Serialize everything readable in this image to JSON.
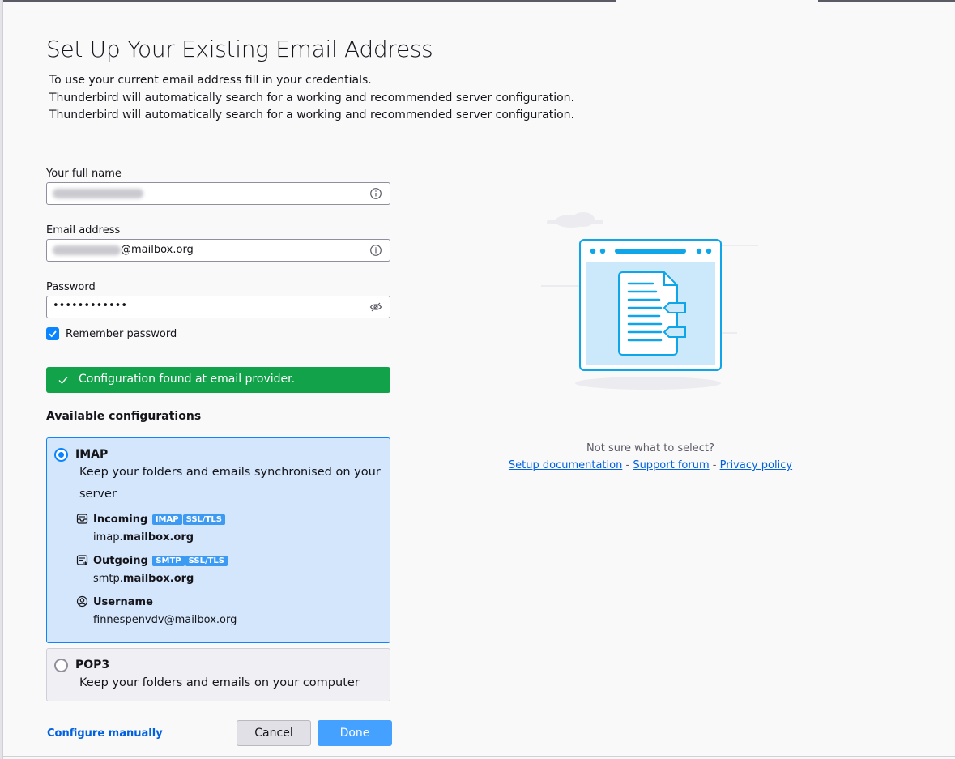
{
  "page": {
    "title": "Set Up Your Existing Email Address",
    "intro": [
      "To use your current email address fill in your credentials.",
      "Thunderbird will automatically search for a working and recommended server configuration.",
      "Thunderbird will automatically search for a working and recommended server configuration."
    ]
  },
  "form": {
    "name_label": "Your full name",
    "email_label": "Email address",
    "email_suffix": "@mailbox.org",
    "password_label": "Password",
    "password_value": "••••••••••••",
    "remember_label": "Remember password",
    "remember_checked": true
  },
  "notice": {
    "text": "Configuration found at email provider."
  },
  "configs": {
    "heading": "Available configurations",
    "imap": {
      "title": "IMAP",
      "desc_line1": "Keep your folders and emails synchronised on your",
      "desc_line2": "server",
      "incoming_label": "Incoming",
      "incoming_badges": [
        "IMAP",
        "SSL/TLS"
      ],
      "incoming_host_prefix": "imap.",
      "incoming_host_domain": "mailbox.org",
      "outgoing_label": "Outgoing",
      "outgoing_badges": [
        "SMTP",
        "SSL/TLS"
      ],
      "outgoing_host_prefix": "smtp.",
      "outgoing_host_domain": "mailbox.org",
      "username_label": "Username",
      "username_value": "finnespenvdv@mailbox.org"
    },
    "pop3": {
      "title": "POP3",
      "desc": "Keep your folders and emails on your computer"
    }
  },
  "actions": {
    "configure_manually": "Configure manually",
    "cancel": "Cancel",
    "done": "Done"
  },
  "help": {
    "question": "Not sure what to select?",
    "setup_doc": "Setup documentation",
    "separator": "-",
    "support_forum": "Support forum",
    "privacy_policy": "Privacy policy"
  },
  "colors": {
    "accent": "#0a84ff",
    "success": "#12a34a",
    "selected_bg": "#d3e6fb",
    "badge": "#3c9af2",
    "link": "#0060df"
  },
  "icons": {
    "info": "info-icon",
    "eye": "eye-slash-icon",
    "check": "check-icon",
    "inbox": "inbox-icon",
    "outbox": "outbox-icon",
    "user": "user-circle-icon"
  }
}
